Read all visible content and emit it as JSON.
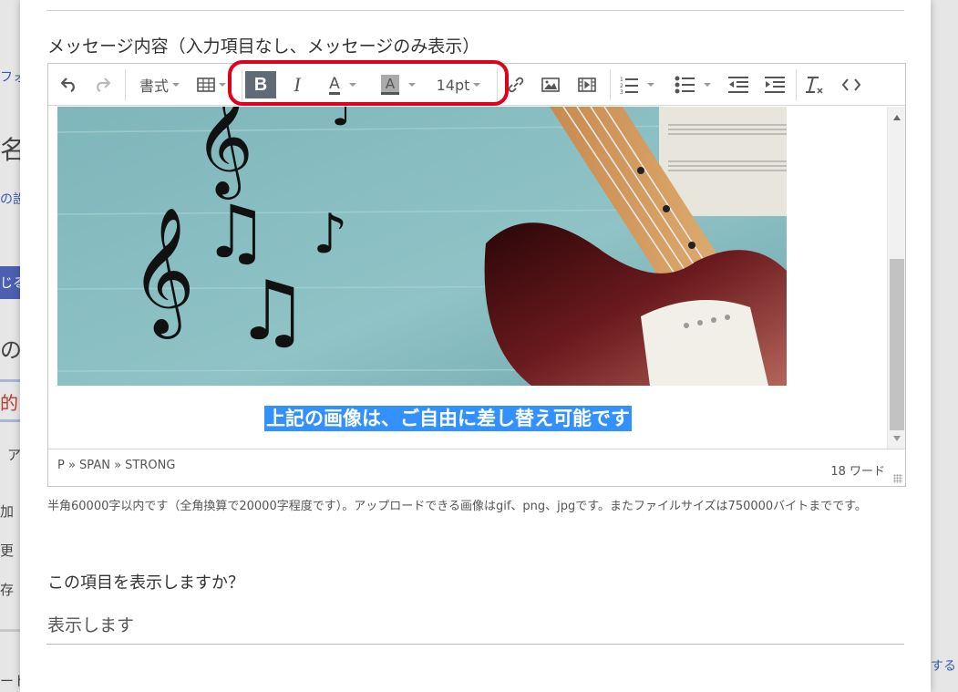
{
  "background": {
    "left_fragments": [
      "フォ",
      "名",
      "の設",
      "じる",
      "の",
      "的",
      "ア",
      "加",
      "更",
      "存",
      "ート"
    ],
    "right_fragments": [
      "する"
    ]
  },
  "field": {
    "label": "メッセージ内容（入力項目なし、メッセージのみ表示）"
  },
  "toolbar": {
    "undo": "undo-icon",
    "redo": "redo-icon",
    "format_label": "書式",
    "table": "table-icon",
    "bold_label": "B",
    "italic_label": "I",
    "font_color_label": "A",
    "bg_color_label": "A",
    "font_size_label": "14pt",
    "link": "link-icon",
    "image": "image-icon",
    "media": "media-icon",
    "ordered_list": "ordered-list-icon",
    "bullet_list": "bullet-list-icon",
    "outdent": "outdent-icon",
    "indent": "indent-icon",
    "clear_format": "clear-format-icon",
    "code": "code-icon",
    "highlight_color": "#e0001b"
  },
  "content": {
    "caption": "上記の画像は、ご自由に差し替え可能です",
    "selection_color": "#3390ff"
  },
  "statusbar": {
    "path": "P » SPAN » STRONG",
    "word_count": "18 ワード"
  },
  "help_text": "半角60000字以内です（全角換算で20000字程度です）。アップロードできる画像はgif、png、jpgです。またファイルサイズは750000バイトまでです。",
  "display_question": "この項目を表示しますか？",
  "display_answer": "表示します"
}
